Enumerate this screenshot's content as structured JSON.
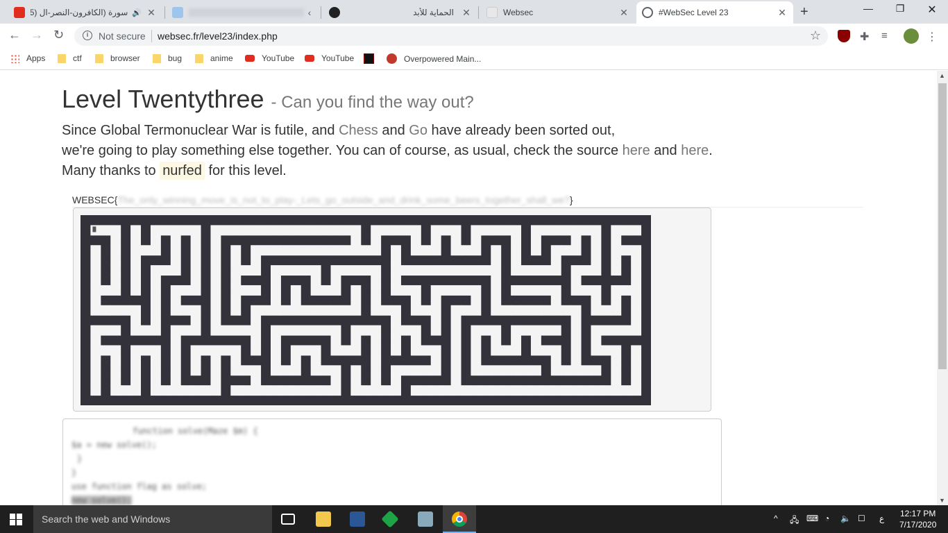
{
  "browser": {
    "tabs": [
      {
        "title": "سورة (الكافرون-النصر-ال (95)",
        "active": false
      },
      {
        "title": "",
        "active": false
      },
      {
        "title": "الحماية للأبد",
        "active": false
      },
      {
        "title": "Websec",
        "active": false
      },
      {
        "title": "#WebSec Level 23",
        "active": true
      }
    ],
    "new_tab": "+",
    "security_label": "Not secure",
    "url": "websec.fr/level23/index.php",
    "bookmarks": [
      "Apps",
      "ctf",
      "browser",
      "bug",
      "anime",
      "YouTube",
      "YouTube",
      "",
      "Overpowered Main..."
    ]
  },
  "page": {
    "title": "Level Twentythree",
    "subtitle": "- Can you find the way out?",
    "intro": {
      "l1_a": "Since Global Termonuclear War is futile, and",
      "chess": "Chess",
      "and": "and",
      "go": "Go",
      "l1_b": "have already been sorted out,",
      "l2_a": "we're going to play something else together. You can of course, as usual, check the source",
      "here1": "here",
      "here2": "here",
      "dot": ".",
      "l3_a": "Many thanks to",
      "author": "nurfed",
      "l3_b": "for this level."
    },
    "flag_prefix": "WEBSEC{",
    "flag_hidden": "The_only_winning_move_is_not_to_play-_Lets_go_outside_and_drink_some_beers_together_shall_we?",
    "flag_suffix": "}",
    "code_lines": [
      "function solve(Maze $m) {",
      "$a = new solve();",
      "}",
      "}",
      "use function flag as solve;",
      "new solve();"
    ]
  },
  "taskbar": {
    "search_placeholder": "Search the web and Windows",
    "time": "12:17 PM",
    "date": "7/17/2020",
    "lang": "ع"
  },
  "colors": {
    "accent": "#77b3f0",
    "link": "#777777",
    "maze_wall": "#33323a",
    "maze_path": "#f4f4f4"
  }
}
